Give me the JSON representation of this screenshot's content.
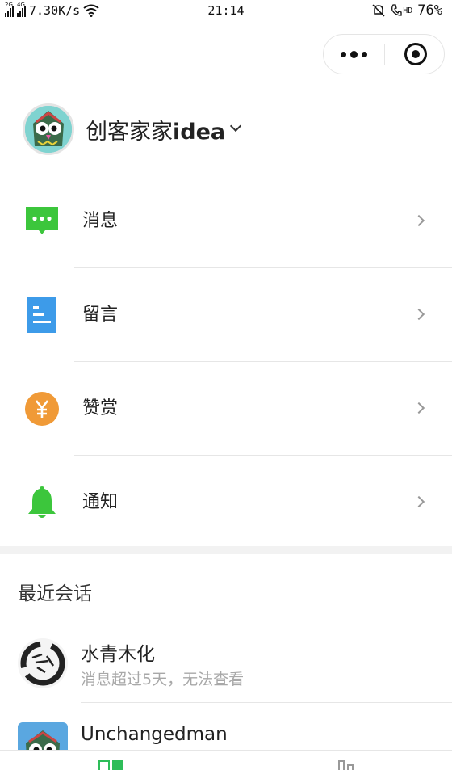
{
  "status_bar": {
    "network_left": "2G",
    "network_right": "4G",
    "speed": "7.30K/s",
    "time": "21:14",
    "hd_label": "HD",
    "battery": "76%"
  },
  "capsule": {
    "more_icon": "more-dots-icon",
    "close_icon": "target-close-icon"
  },
  "account": {
    "name_cjk": "创客家家",
    "name_latin": "idea"
  },
  "menu": [
    {
      "label": "消息",
      "icon": "message-icon",
      "color": "#3cc63c"
    },
    {
      "label": "留言",
      "icon": "comment-doc-icon",
      "color": "#3d9be9"
    },
    {
      "label": "赞赏",
      "icon": "yen-coin-icon",
      "color": "#f09a37"
    },
    {
      "label": "通知",
      "icon": "bell-icon",
      "color": "#3cc63c"
    }
  ],
  "recent": {
    "title": "最近会话",
    "conversations": [
      {
        "name": "水青木化",
        "subtitle": "消息超过5天，无法查看"
      },
      {
        "name": "Unchangedman",
        "subtitle": ""
      }
    ]
  },
  "colors": {
    "accent_green": "#2ebd59",
    "muted_text": "#a8a8a8"
  }
}
